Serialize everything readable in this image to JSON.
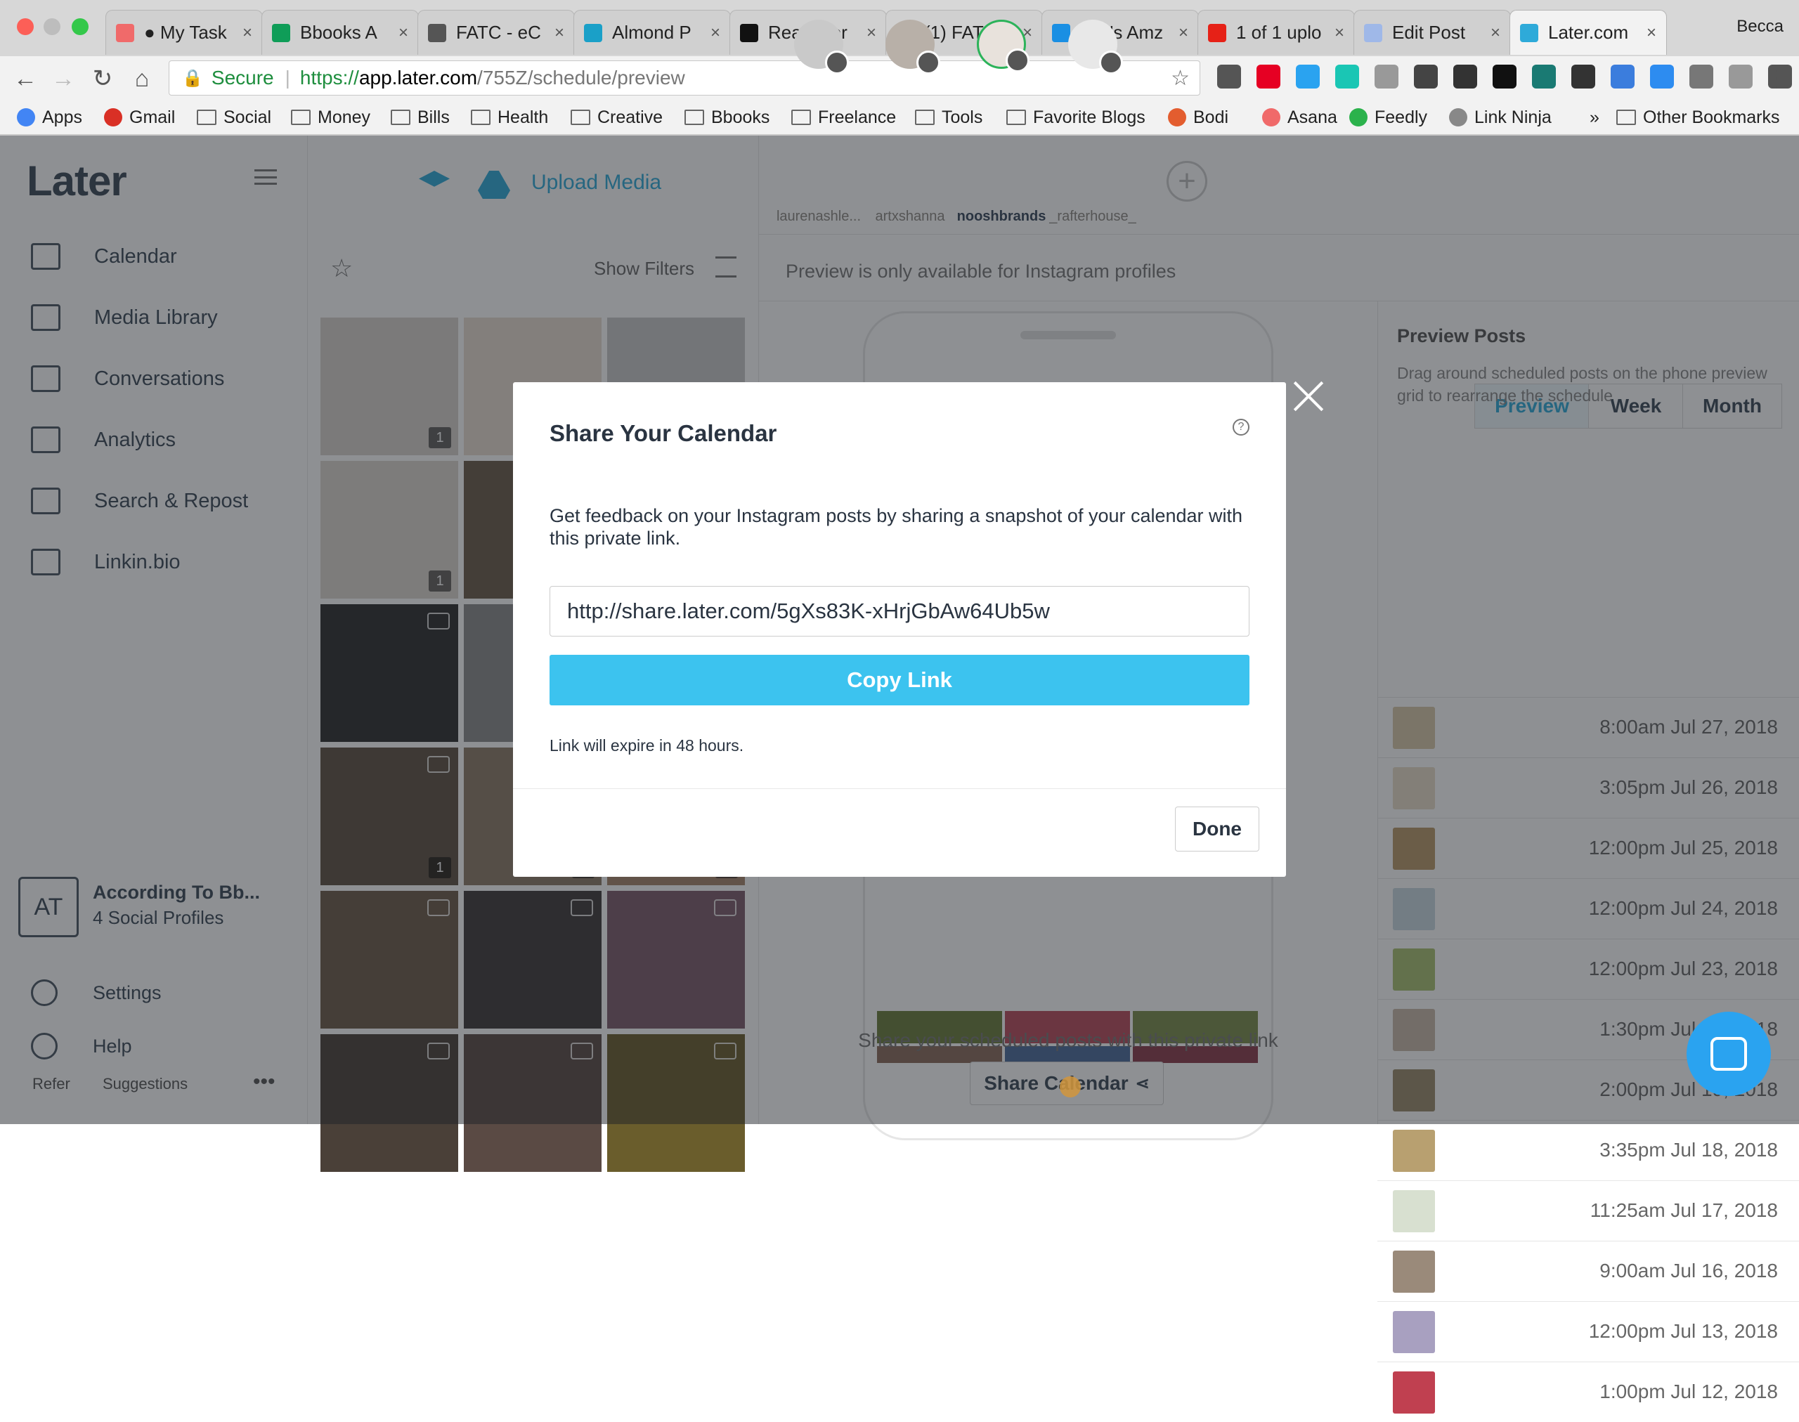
{
  "browser": {
    "tabs": [
      {
        "title": "● My Task",
        "color": "#f06a6a"
      },
      {
        "title": "Bbooks A",
        "color": "#0f9d58"
      },
      {
        "title": "FATC - eC",
        "color": "#555555"
      },
      {
        "title": "Almond P",
        "color": "#1aa0c8"
      },
      {
        "title": "Ready for",
        "color": "#111111"
      },
      {
        "title": "(1) FATC -",
        "color": "#3b5998"
      },
      {
        "title": "Yev's Amz",
        "color": "#1a8fe3"
      },
      {
        "title": "1 of 1 uplo",
        "color": "#e62117"
      },
      {
        "title": "Edit Post",
        "color": "#9fb8e8"
      },
      {
        "title": "Later.com",
        "color": "#2eaad9"
      }
    ],
    "profile_name": "Becca",
    "secure_label": "Secure",
    "url_scheme": "https://",
    "url_host": "app.later.com",
    "url_path": "/755Z/schedule/preview",
    "bookmarks": [
      "Apps",
      "Gmail",
      "Social",
      "Money",
      "Bills",
      "Health",
      "Creative",
      "Bbooks",
      "Freelance",
      "Tools",
      "Favorite Blogs",
      "Bodi",
      "Asana",
      "Feedly",
      "Link Ninja"
    ],
    "bookmarks_overflow": "»",
    "other_bookmarks": "Other Bookmarks"
  },
  "sidebar": {
    "logo": "Later",
    "items": [
      {
        "label": "Calendar"
      },
      {
        "label": "Media Library"
      },
      {
        "label": "Conversations"
      },
      {
        "label": "Analytics"
      },
      {
        "label": "Search & Repost"
      },
      {
        "label": "Linkin.bio"
      }
    ],
    "account": {
      "initials": "AT",
      "name": "According To Bb...",
      "profiles": "4 Social Profiles"
    },
    "settings": "Settings",
    "help": "Help",
    "refer": "Refer",
    "suggestions": "Suggestions",
    "more": "•••"
  },
  "media": {
    "upload_label": "Upload Media",
    "show_filters": "Show Filters",
    "thumb_badges": [
      "1",
      "",
      "",
      "1",
      "",
      "1",
      "",
      "1",
      "",
      "1",
      "1",
      "1"
    ]
  },
  "profiles": [
    {
      "handle": "laurenashle...",
      "bold": false
    },
    {
      "handle": "artxshanna",
      "bold": false
    },
    {
      "handle": "nooshbrands",
      "bold": true
    },
    {
      "handle": "_rafterhouse_",
      "bold": false
    }
  ],
  "schedule": {
    "preview_msg": "Preview is only available for Instagram profiles",
    "view_tabs": [
      "Preview",
      "Week",
      "Month"
    ],
    "share_msg": "Share your scheduled posts with this private link",
    "share_button": "Share Calendar"
  },
  "preview_posts": {
    "title": "Preview Posts",
    "desc": "Drag around scheduled posts on the phone preview grid to rearrange the schedule",
    "rows": [
      "8:00am Jul 27, 2018",
      "3:05pm Jul 26, 2018",
      "12:00pm Jul 25, 2018",
      "12:00pm Jul 24, 2018",
      "12:00pm Jul 23, 2018",
      "1:30pm Jul 20, 2018",
      "2:00pm Jul 19, 2018",
      "3:35pm Jul 18, 2018",
      "11:25am Jul 17, 2018",
      "9:00am Jul 16, 2018",
      "12:00pm Jul 13, 2018",
      "1:00pm Jul 12, 2018"
    ]
  },
  "modal": {
    "title": "Share Your Calendar",
    "help_icon": "?",
    "description": "Get feedback on your Instagram posts by sharing a snapshot of your calendar with this private link.",
    "link": "http://share.later.com/5gXs83K-xHrjGbAw64Ub5w",
    "copy_button": "Copy Link",
    "expiry": "Link will expire in 48 hours.",
    "done_button": "Done"
  },
  "colors": {
    "accent": "#2eaad9",
    "copy_button": "#3cc3ef",
    "overlay": "rgba(30,34,40,.5)"
  }
}
